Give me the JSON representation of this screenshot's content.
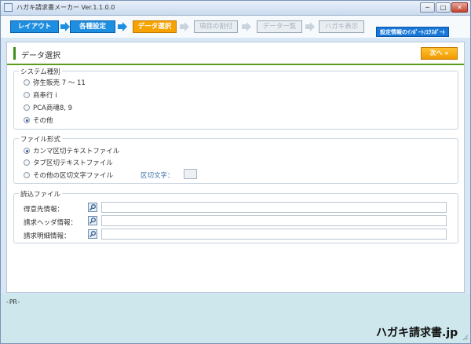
{
  "window": {
    "title": "ハガキ請求書メーカー Ver.1.1.0.0",
    "buttons": {
      "minimize": "─",
      "maximize": "□",
      "close": "✕"
    }
  },
  "steps": [
    {
      "label": "レイアウト",
      "state": "done"
    },
    {
      "label": "各種設定",
      "state": "done"
    },
    {
      "label": "データ選択",
      "state": "active"
    },
    {
      "label": "項目の割付",
      "state": "disabled"
    },
    {
      "label": "データ一覧",
      "state": "disabled"
    },
    {
      "label": "ハガキ表示",
      "state": "disabled"
    }
  ],
  "import_export_label": "設定情報のｲﾝﾎﾟｰﾄ/ｴｸｽﾎﾟｰﾄ",
  "page": {
    "title": "データ選択",
    "next_label": "次へ",
    "next_icon": "double-chevron-right-icon"
  },
  "system_group": {
    "label": "システム種別",
    "options": [
      "弥生販売 7 ～ 11",
      "商奉行 i",
      "PCA商魂8, 9",
      "その他"
    ],
    "selected": "その他"
  },
  "format_group": {
    "label": "ファイル形式",
    "options": [
      "カンマ区切テキストファイル",
      "タブ区切テキストファイル",
      "その他の区切文字ファイル"
    ],
    "selected": "カンマ区切テキストファイル",
    "separator_label": "区切文字：",
    "separator_value": ""
  },
  "files_group": {
    "label": "読込ファイル",
    "rows": [
      {
        "label": "得意先情報：",
        "value": ""
      },
      {
        "label": "請求ヘッダ情報：",
        "value": ""
      },
      {
        "label": "請求明細情報：",
        "value": ""
      }
    ]
  },
  "footer": {
    "pr_label": "-PR-",
    "brand": "ハガキ請求書.jp"
  },
  "colors": {
    "step_done": "#1e8ee0",
    "step_active": "#f6a200",
    "step_disabled": "#e9eef3",
    "accent_green": "#5a9c1e",
    "footer_bg": "#cde7ec"
  }
}
